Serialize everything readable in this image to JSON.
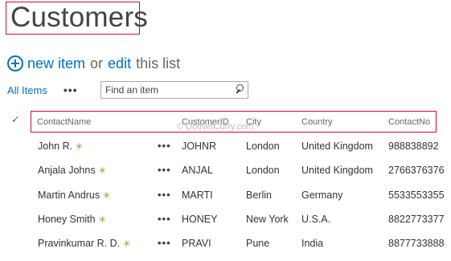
{
  "page": {
    "title": "Customers"
  },
  "actions": {
    "new_item": "new item",
    "or": "or",
    "edit": "edit",
    "this_list": "this list"
  },
  "toolbar": {
    "view_label": "All Items",
    "more": "•••",
    "search_placeholder": "Find an item"
  },
  "table": {
    "check_glyph": "✓",
    "columns": [
      "ContactName",
      "CustomerID",
      "City",
      "Country",
      "ContactNo"
    ],
    "watermark": "© DotNetCurry.com",
    "new_glyph": "✳",
    "ellipsis": "•••",
    "rows": [
      [
        "John R.",
        "JOHNR",
        "London",
        "United Kingdom",
        "988838892"
      ],
      [
        "Anjala Johns",
        "ANJAL",
        "London",
        "United Kingdom",
        "2766376376"
      ],
      [
        "Martin Andrus",
        "MARTI",
        "Berlin",
        "Germany",
        "5533553355"
      ],
      [
        "Honey Smith",
        "HONEY",
        "New York",
        "U.S.A.",
        "8822773377"
      ],
      [
        "Pravinkumar R. D.",
        "PRAVI",
        "Pune",
        "India",
        "8877733888"
      ]
    ]
  },
  "colors": {
    "accent": "#0072c6",
    "highlight_border": "#c8102e",
    "new_mark": "#6aa51e"
  }
}
